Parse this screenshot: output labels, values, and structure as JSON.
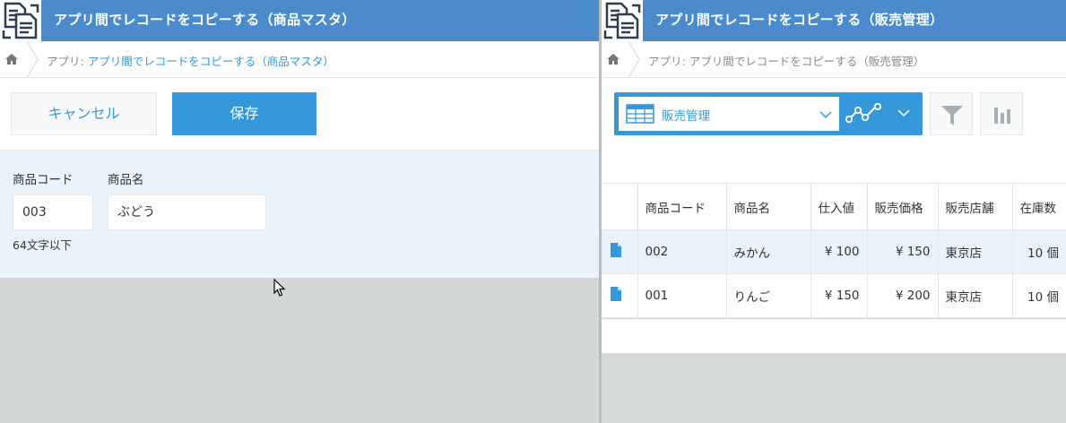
{
  "left": {
    "app_title": "アプリ間でレコードをコピーする（商品マスタ）",
    "breadcrumb": {
      "prefix": "アプリ: ",
      "link": "アプリ間でレコードをコピーする（商品マスタ）"
    },
    "toolbar": {
      "cancel_label": "キャンセル",
      "save_label": "保存"
    },
    "form": {
      "code_label": "商品コード",
      "code_value": "003",
      "name_label": "商品名",
      "name_value": "ぶどう",
      "code_hint": "64文字以下"
    }
  },
  "right": {
    "app_title": "アプリ間でレコードをコピーする（販売管理）",
    "breadcrumb": {
      "prefix": "アプリ: ",
      "text": "アプリ間でレコードをコピーする（販売管理）"
    },
    "view": {
      "selected": "販売管理"
    },
    "table": {
      "headers": [
        "商品コード",
        "商品名",
        "仕入値",
        "販売価格",
        "販売店舗",
        "在庫数"
      ],
      "rows": [
        [
          "002",
          "みかん",
          "¥ 100",
          "¥ 150",
          "東京店",
          "10 個"
        ],
        [
          "001",
          "りんご",
          "¥ 150",
          "¥ 200",
          "東京店",
          "10 個"
        ]
      ]
    }
  },
  "colors": {
    "titlebar": "#4b8bcb",
    "accent": "#3498db",
    "form_bg": "#e8f3fc"
  },
  "icons": [
    "app-icon",
    "home-icon",
    "table-view-icon",
    "chevron-down-icon",
    "graph-icon",
    "filter-icon",
    "bar-chart-icon",
    "record-detail-icon",
    "mouse-cursor-icon"
  ]
}
